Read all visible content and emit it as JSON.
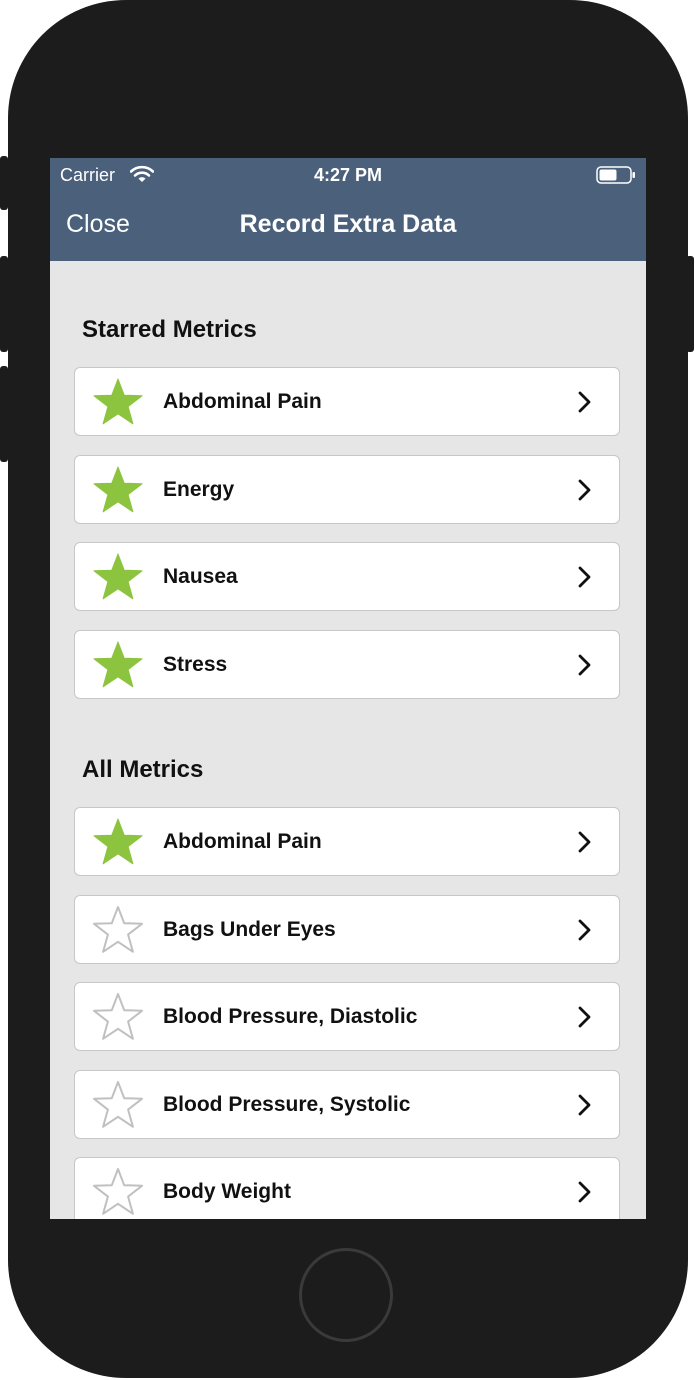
{
  "status_bar": {
    "carrier": "Carrier",
    "time": "4:27 PM"
  },
  "nav": {
    "close_label": "Close",
    "title": "Record Extra Data"
  },
  "starred_section": {
    "title": "Starred Metrics",
    "items": [
      {
        "label": "Abdominal Pain",
        "starred": true
      },
      {
        "label": "Energy",
        "starred": true
      },
      {
        "label": "Nausea",
        "starred": true
      },
      {
        "label": "Stress",
        "starred": true
      }
    ]
  },
  "all_section": {
    "title": "All Metrics",
    "items": [
      {
        "label": "Abdominal Pain",
        "starred": true
      },
      {
        "label": "Bags Under Eyes",
        "starred": false
      },
      {
        "label": "Blood Pressure, Diastolic",
        "starred": false
      },
      {
        "label": "Blood Pressure, Systolic",
        "starred": false
      },
      {
        "label": "Body Weight",
        "starred": false
      }
    ]
  },
  "colors": {
    "header_background": "#4a607b",
    "screen_background": "#e6e6e6",
    "starred_star": "#8cc43f",
    "unstarred_star": "#c0c0c0"
  }
}
